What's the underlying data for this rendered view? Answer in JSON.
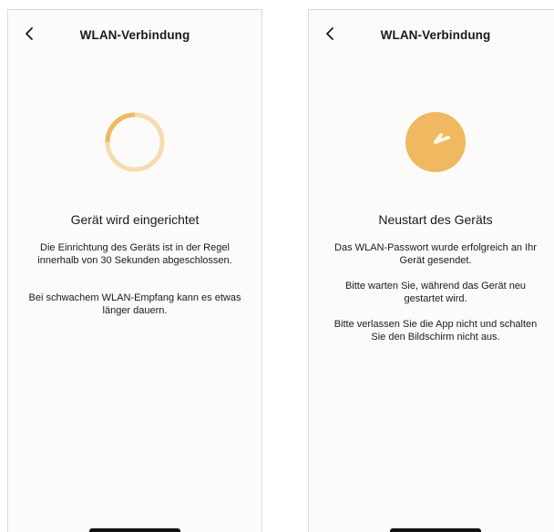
{
  "colors": {
    "accent": "#f0b860",
    "accent_light": "#f5dcb0",
    "text": "#1a1a1a",
    "screen_bg": "#fcfbf9"
  },
  "left_screen": {
    "title": "WLAN-Verbindung",
    "back_icon": "chevron-left-icon",
    "status_icon": "loading-ring-icon",
    "heading": "Gerät wird eingerichtet",
    "paragraph1": "Die Einrichtung des Geräts ist in der Regel innerhalb von 30 Sekunden abgeschlossen.",
    "paragraph2": "Bei schwachem WLAN-Empfang kann es etwas länger dauern."
  },
  "right_screen": {
    "title": "WLAN-Verbindung",
    "back_icon": "chevron-left-icon",
    "status_icon": "clock-icon",
    "heading": "Neustart des Geräts",
    "paragraph1": "Das WLAN-Passwort wurde erfolgreich an Ihr Gerät gesendet.",
    "paragraph2": "Bitte warten Sie, während das Gerät neu gestartet wird.",
    "paragraph3": "Bitte verlassen Sie die App nicht und schalten Sie den Bildschirm nicht aus."
  }
}
